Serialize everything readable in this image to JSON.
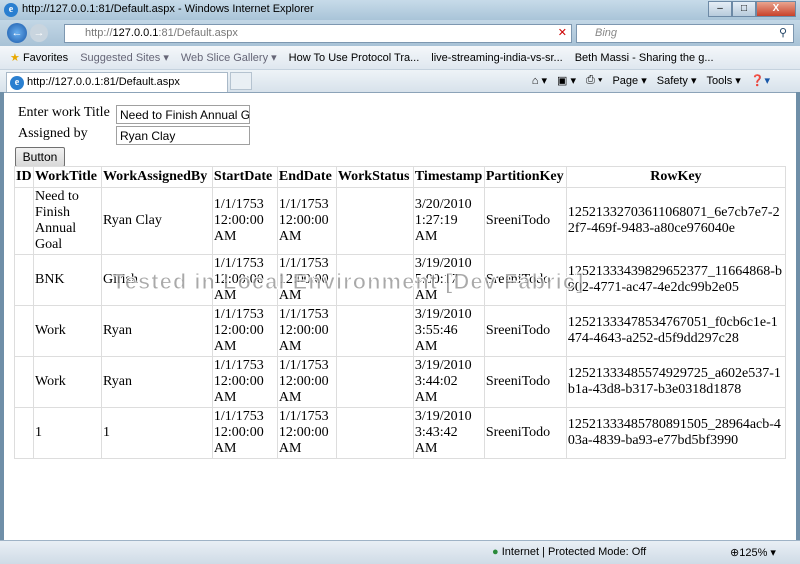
{
  "window": {
    "title": "http://127.0.0.1:81/Default.aspx - Windows Internet Explorer"
  },
  "nav": {
    "address_prefix": "http://",
    "address_host": "127.0.0.1",
    "address_rest": ":81/Default.aspx",
    "search_placeholder": "Bing"
  },
  "favorites": {
    "label": "Favorites",
    "items": [
      "Suggested Sites ▾",
      "Web Slice Gallery ▾",
      "How To Use Protocol Tra...",
      "live-streaming-india-vs-sr...",
      "Beth Massi - Sharing the g..."
    ]
  },
  "tab": {
    "label": "http://127.0.0.1:81/Default.aspx"
  },
  "commands": {
    "page": "Page ▾",
    "safety": "Safety ▾",
    "tools": "Tools ▾"
  },
  "form": {
    "title_label": "Enter work Title",
    "title_value": "Need to Finish Annual Goal",
    "assigned_label": "Assigned by",
    "assigned_value": "Ryan Clay",
    "button": "Button"
  },
  "table": {
    "headers": [
      "ID",
      "WorkTitle",
      "WorkAssignedBy",
      "StartDate",
      "EndDate",
      "WorkStatus",
      "Timestamp",
      "PartitionKey",
      "RowKey"
    ],
    "rows": [
      [
        "",
        "Need to Finish Annual Goal",
        "Ryan Clay",
        "1/1/1753 12:00:00 AM",
        "1/1/1753 12:00:00 AM",
        "",
        "3/20/2010 1:27:19 AM",
        "SreeniTodo",
        "12521332703611068071_6e7cb7e7-22f7-469f-9483-a80ce976040e"
      ],
      [
        "",
        "BNK",
        "Girish",
        "1/1/1753 12:00:00 AM",
        "1/1/1753 12:00:00 AM",
        "",
        "3/19/2010 5:00:17 AM",
        "SreeniTodo",
        "12521333439829652377_11664868-b902-4771-ac47-4e2dc99b2e05"
      ],
      [
        "",
        "Work",
        "Ryan",
        "1/1/1753 12:00:00 AM",
        "1/1/1753 12:00:00 AM",
        "",
        "3/19/2010 3:55:46 AM",
        "SreeniTodo",
        "12521333478534767051_f0cb6c1e-1474-4643-a252-d5f9dd297c28"
      ],
      [
        "",
        "Work",
        "Ryan",
        "1/1/1753 12:00:00 AM",
        "1/1/1753 12:00:00 AM",
        "",
        "3/19/2010 3:44:02 AM",
        "SreeniTodo",
        "12521333485574929725_a602e537-1b1a-43d8-b317-b3e0318d1878"
      ],
      [
        "",
        "1",
        "1",
        "1/1/1753 12:00:00 AM",
        "1/1/1753 12:00:00 AM",
        "",
        "3/19/2010 3:43:42 AM",
        "SreeniTodo",
        "12521333485780891505_28964acb-403a-4839-ba93-e77bd5bf3990"
      ]
    ]
  },
  "watermark": "Tested in Local Environment [Dev Fabric]",
  "status": {
    "zone": "Internet | Protected Mode: Off",
    "zoom": "125%"
  }
}
